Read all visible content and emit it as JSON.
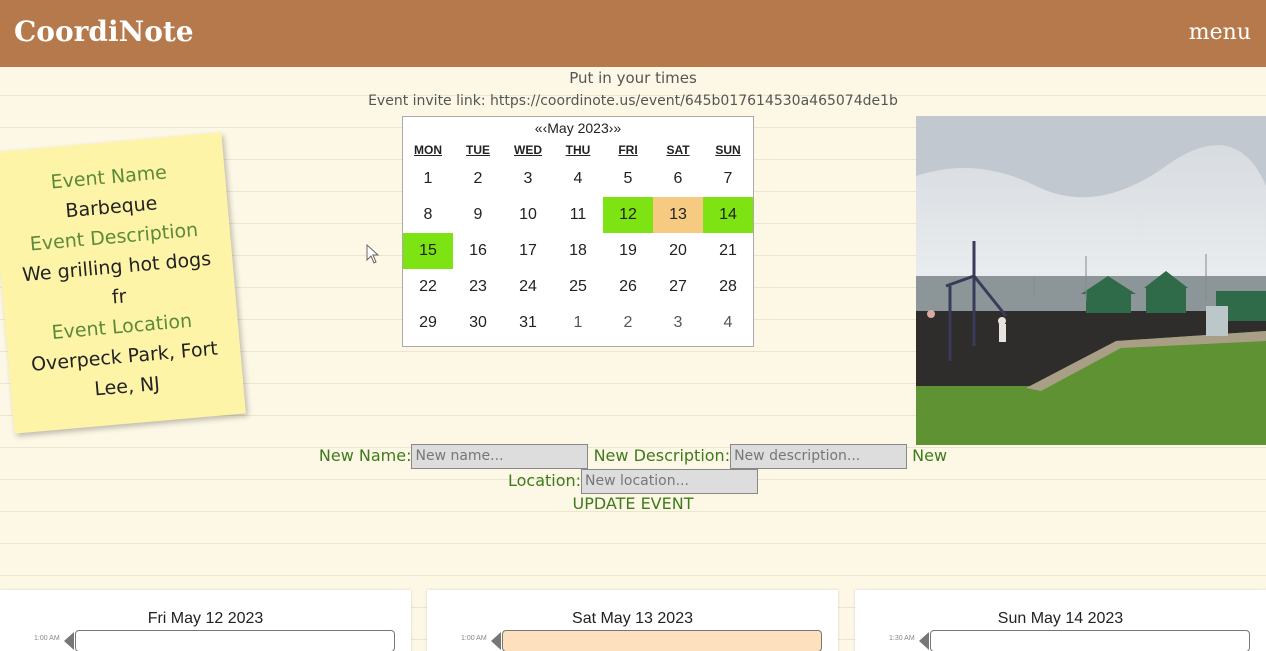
{
  "header": {
    "title": "CoordiNote",
    "menu_label": "menu"
  },
  "instructions": "Put in your times",
  "invite_link": "Event invite link: https://coordinote.us/event/645b017614530a465074de1b",
  "note": {
    "name_label": "Event Name",
    "name_value": "Barbeque",
    "description_label": "Event Description",
    "description_line1": "We grilling hot dogs",
    "description_line2": "fr",
    "location_label": "Event Location",
    "location_line1": "Overpeck Park, Fort",
    "location_line2": "Lee, NJ"
  },
  "calendar": {
    "prev_label": "«‹",
    "month_label": "May 2023",
    "next_label": "›»",
    "weekdays": [
      "MON",
      "TUE",
      "WED",
      "THU",
      "FRI",
      "SAT",
      "SUN"
    ],
    "weeks": [
      [
        "1",
        "2",
        "3",
        "4",
        "5",
        "6",
        "7"
      ],
      [
        "8",
        "9",
        "10",
        "11",
        "12",
        "13",
        "14"
      ],
      [
        "15",
        "16",
        "17",
        "18",
        "19",
        "20",
        "21"
      ],
      [
        "22",
        "23",
        "24",
        "25",
        "26",
        "27",
        "28"
      ],
      [
        "29",
        "30",
        "31",
        "1",
        "2",
        "3",
        "4"
      ]
    ],
    "highlight_green": [
      "12",
      "14",
      "15"
    ],
    "highlight_tan": [
      "13"
    ],
    "colors": {
      "green": "#7ee312",
      "tan": "#f7ca82"
    }
  },
  "form": {
    "name_label": "New Name:",
    "name_placeholder": "New name...",
    "description_label": "New Description:",
    "description_placeholder": "New description...",
    "location_label_part1": "New",
    "location_label_part2": "Location:",
    "location_placeholder": "New location...",
    "update_button": "UPDATE EVENT"
  },
  "days": [
    {
      "title": "Fri May 12 2023",
      "time": "1:00 AM"
    },
    {
      "title": "Sat May 13 2023",
      "time": "1:00 AM"
    },
    {
      "title": "Sun May 14 2023",
      "time": "1:30 AM"
    }
  ],
  "colors": {
    "header": "#b5794b",
    "background": "#fdf8e6",
    "note": "#fef4a8",
    "accent_green": "#3f7a1c"
  }
}
